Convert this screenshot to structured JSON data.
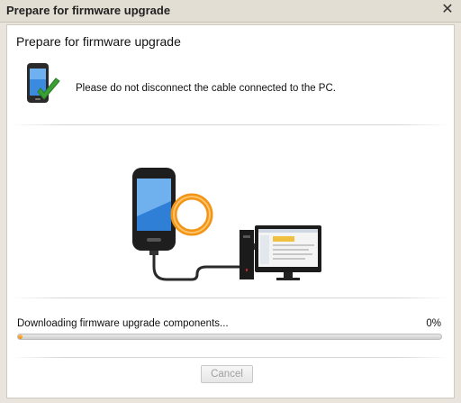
{
  "window": {
    "title": "Prepare for firmware upgrade"
  },
  "panel": {
    "heading": "Prepare for firmware upgrade",
    "notice": "Please do not disconnect the cable connected to the PC."
  },
  "progress": {
    "status": "Downloading firmware upgrade components...",
    "percent_label": "0%",
    "value": 0
  },
  "buttons": {
    "cancel": "Cancel",
    "cancel_enabled": false
  },
  "icons": {
    "close": "close-icon",
    "phone_check": "phone-checkmark-icon",
    "illustration": "phone-connected-to-pc-illustration"
  },
  "colors": {
    "progress_fill": "#f08a00",
    "checkmark": "#3aa033"
  }
}
